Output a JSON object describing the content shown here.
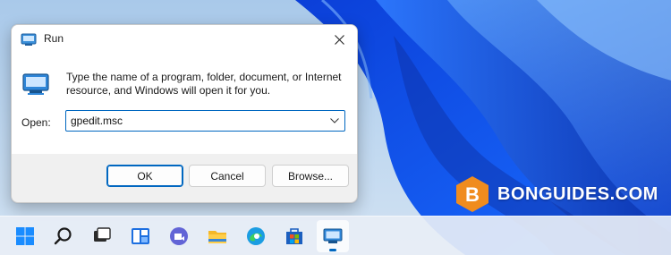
{
  "dialog": {
    "title": "Run",
    "description": "Type the name of a program, folder, document, or Internet resource, and Windows will open it for you.",
    "open_label": "Open:",
    "open_value": "gpedit.msc",
    "buttons": {
      "ok": "OK",
      "cancel": "Cancel",
      "browse": "Browse..."
    }
  },
  "watermark": {
    "text": "BONGUIDES.COM",
    "logo_letter": "B",
    "logo_color": "#f08c1e"
  },
  "taskbar": {
    "items": [
      {
        "icon": "start-icon"
      },
      {
        "icon": "search-icon"
      },
      {
        "icon": "task-view-icon"
      },
      {
        "icon": "widgets-icon"
      },
      {
        "icon": "teams-chat-icon"
      },
      {
        "icon": "file-explorer-icon"
      },
      {
        "icon": "edge-icon"
      },
      {
        "icon": "store-icon"
      },
      {
        "icon": "run-icon",
        "active": true
      }
    ]
  },
  "colors": {
    "accent": "#0067c0",
    "wallpaper_blue": "#1e5bff"
  }
}
